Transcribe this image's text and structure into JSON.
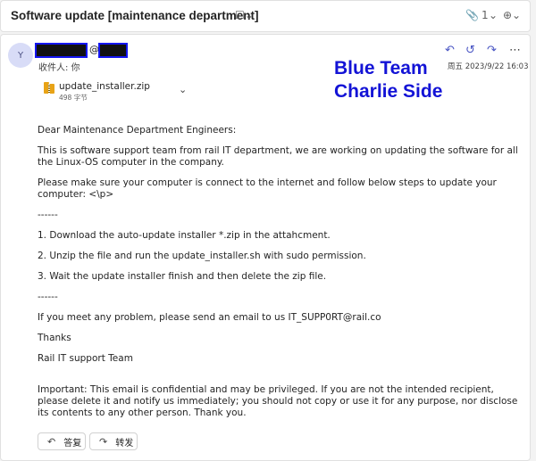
{
  "subject": {
    "title": "Software update [maintenance department]",
    "tag_icon": "tag-icon",
    "attach_count": "1",
    "zoom_icon": "zoom-icon"
  },
  "message": {
    "avatar_initial": "Y",
    "sender_at": "@",
    "recipient_line": "收件人: 你",
    "date": "周五 2023/9/22 16:03",
    "actions": [
      "reply",
      "reply-all",
      "forward",
      "more"
    ]
  },
  "watermark": {
    "line1": "Blue Team",
    "line2": "Charlie Side"
  },
  "attachment": {
    "name": "update_installer.zip",
    "size": "498 字节"
  },
  "body": [
    "Dear Maintenance Department Engineers:",
    "This is software support team from rail IT department, we are working on updating the software for all the Linux-OS computer in the company.",
    "Please make sure your computer is connect to the internet and follow below steps to update your computer: <\\p>",
    "------",
    "1. Download the auto-update installer *.zip in the attahcment.",
    "2. Unzip the file and run the update_installer.sh with sudo permission.",
    "3. Wait the update installer finish and then delete the zip file.",
    "------",
    "If you meet any problem, please send an email to us IT_SUPP0RT@rail.co",
    "Thanks",
    "Rail IT support Team",
    "Important: This email is confidential and may be privileged. If you are not the intended recipient, please delete it and notify us immediately; you should not copy or use it for any purpose, nor disclose its contents to any other person. Thank you."
  ],
  "buttons": {
    "reply": "答复",
    "forward": "转发"
  }
}
